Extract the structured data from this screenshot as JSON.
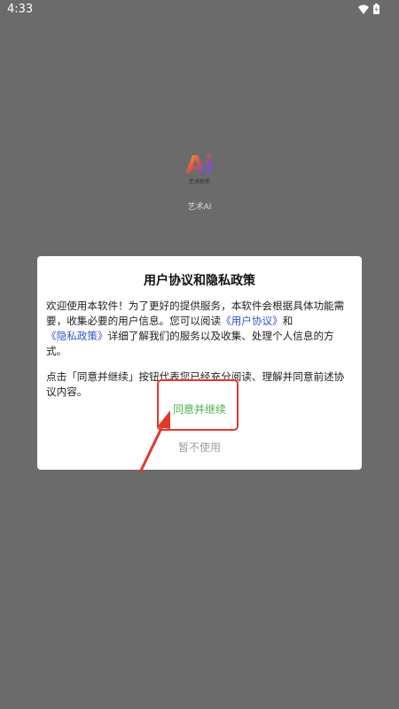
{
  "status_bar": {
    "time": "4:33"
  },
  "app": {
    "logo_text": "Ai",
    "logo_subtext": "艺术助手",
    "name": "艺术AI"
  },
  "dialog": {
    "title": "用户协议和隐私政策",
    "para1_a": "欢迎使用本软件！为了更好的提供服务，本软件会根据具体功能需要，收集必要的用户信息。您可以阅读",
    "link_user_agreement": "《用户协议》",
    "para1_and": "和",
    "link_privacy_policy": "《隐私政策》",
    "para1_b": "详细了解我们的服务以及收集、处理个人信息的方式。",
    "para2": "点击「同意并继续」按钮代表您已经充分阅读、理解并同意前述协议内容。",
    "agree_label": "同意并继续",
    "decline_label": "暂不使用"
  },
  "colors": {
    "backdrop": "#6b6b6b",
    "agree": "#4caf50",
    "link": "#3355cc",
    "annotation": "#e0392b"
  }
}
